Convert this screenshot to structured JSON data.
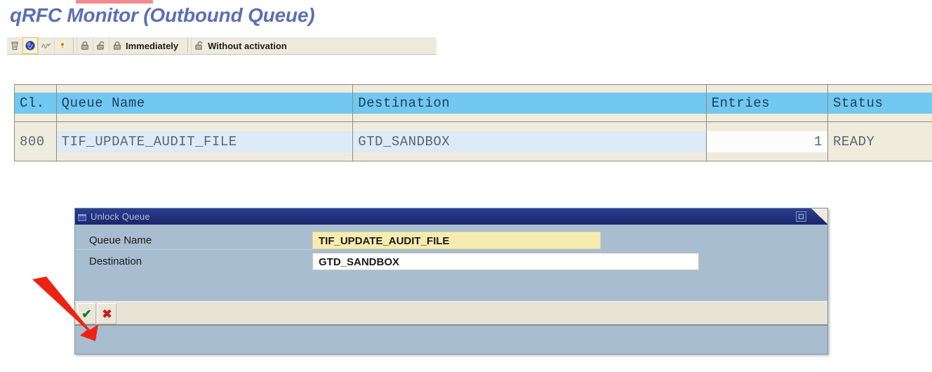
{
  "page": {
    "title": "qRFC Monitor (Outbound Queue)",
    "title_color": "#5b6fb4",
    "marker_color": "#f48a8f"
  },
  "toolbar": {
    "buttons": [
      {
        "name": "delete-icon",
        "glyph": "delete",
        "active": false
      },
      {
        "name": "save-icon",
        "glyph": "save",
        "active": true
      },
      {
        "name": "squiggle-icon",
        "glyph": "squiggle",
        "active": false
      },
      {
        "name": "status-dot-icon",
        "glyph": "dot",
        "active": false
      }
    ],
    "lock_group": [
      {
        "name": "lock-closed-icon",
        "glyph": "lock-closed"
      },
      {
        "name": "lock-open-icon",
        "glyph": "lock-open"
      }
    ],
    "immediately": {
      "icon": "lock-closed-icon",
      "label": "Immediately"
    },
    "without_activation": {
      "icon": "lock-open-icon",
      "label": "Without activation"
    }
  },
  "table": {
    "headers": [
      "Cl.",
      "Queue Name",
      "Destination",
      "Entries",
      "Status"
    ],
    "rows": [
      {
        "client": "800",
        "queue_name": "TIF_UPDATE_AUDIT_FILE",
        "destination": "GTD_SANDBOX",
        "entries": "1",
        "status": "READY"
      }
    ],
    "header_bg": "#71c8f0",
    "cell_bg": "#ddeaf7"
  },
  "dialog": {
    "title": "Unlock Queue",
    "title_icon": "window-icon",
    "control_icon": "restore-icon",
    "fields": [
      {
        "label": "Queue Name",
        "value": "TIF_UPDATE_AUDIT_FILE",
        "placeholder": "",
        "focused": true,
        "bg": "#f7ecaf"
      },
      {
        "label": "Destination",
        "value": "GTD_SANDBOX",
        "placeholder": "",
        "focused": false,
        "bg": "#ffffff"
      }
    ],
    "footer": {
      "confirm_label": "✔",
      "confirm_name": "confirm-button",
      "confirm_color": "#1e7a1e",
      "cancel_label": "✖",
      "cancel_name": "cancel-button",
      "cancel_color": "#c41f1f"
    }
  },
  "annotation": {
    "arrow_color": "#ee2211",
    "points_to": "confirm-button"
  }
}
